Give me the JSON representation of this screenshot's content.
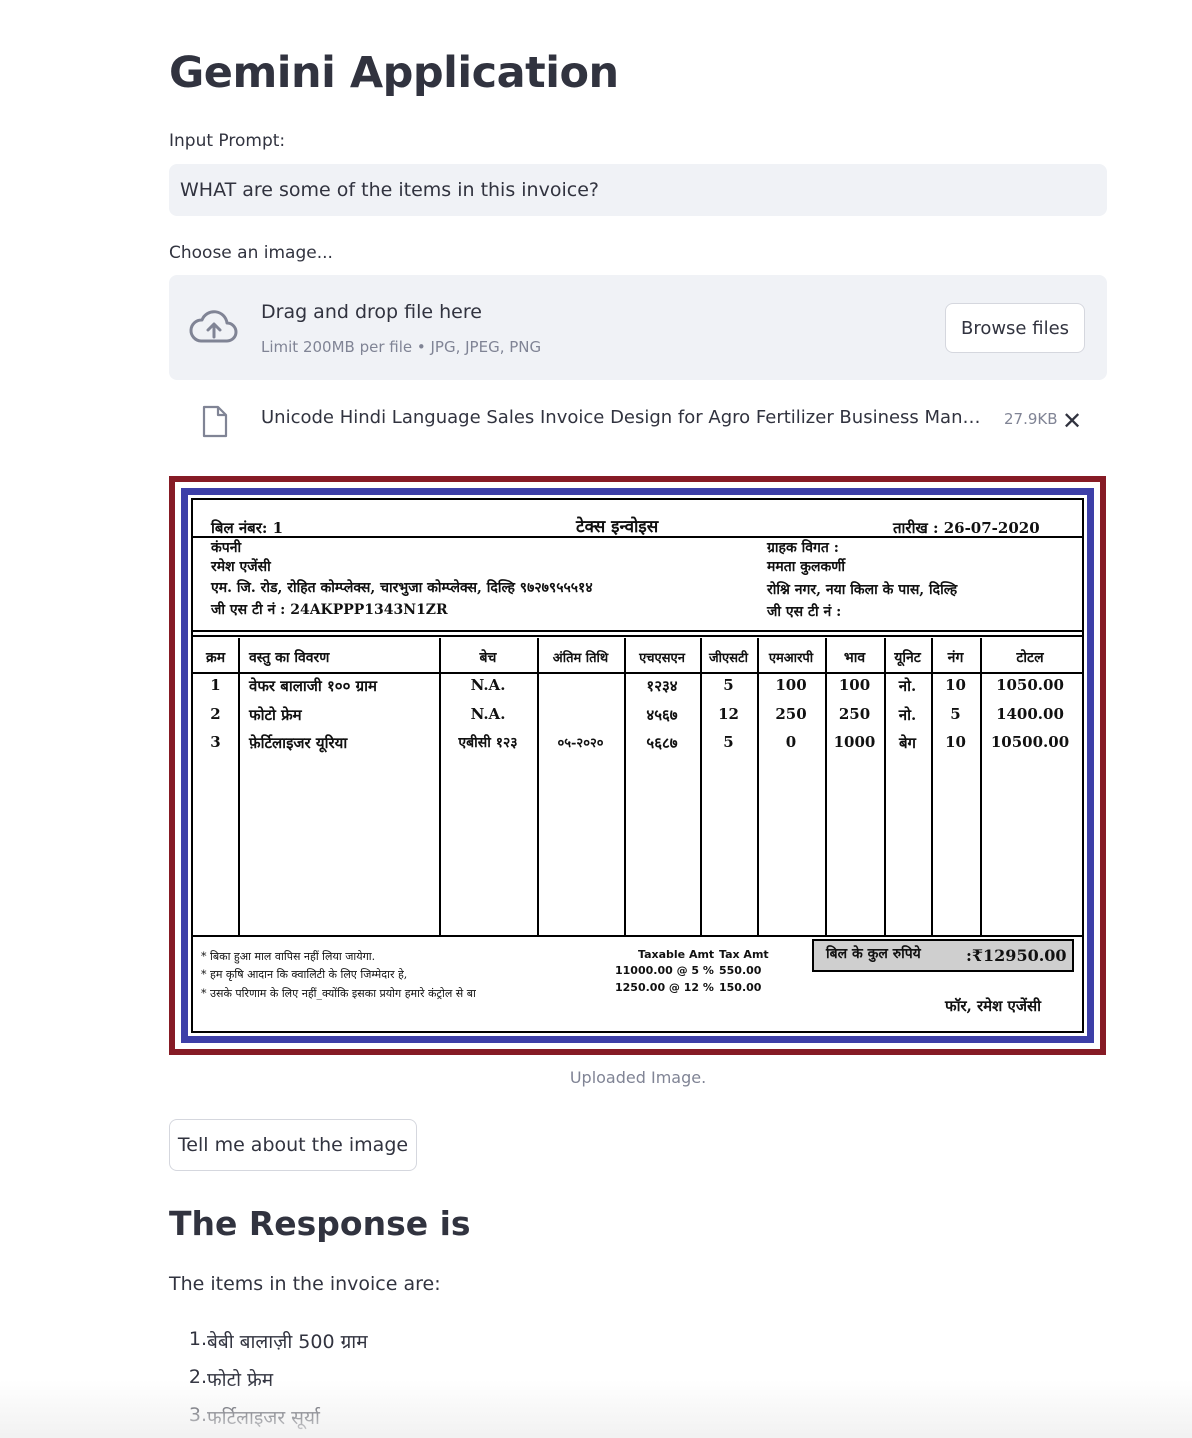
{
  "app": {
    "title": "Gemini Application"
  },
  "prompt": {
    "label": "Input Prompt:",
    "value": "WHAT are some of the items in this invoice?"
  },
  "uploader": {
    "label": "Choose an image...",
    "drop_text": "Drag and drop file here",
    "limit_text": "Limit 200MB per file • JPG, JPEG, PNG",
    "browse_label": "Browse files",
    "file_name": "Unicode Hindi Language Sales Invoice Design for Agro Fertilizer Business Manag…",
    "file_size": "27.9KB",
    "remove_symbol": "✕"
  },
  "invoice": {
    "bill_no": "बिल  नंबर: 1",
    "heading": "टेक्स   इन्वोइस",
    "date": "तारीख :  26-07-2020",
    "company_label": "कंपनी",
    "company_name": "रमेश एजेंसी",
    "company_address": "एम. जि. रोड, रोहित कोम्प्लेक्स, चारभुजा कोम्प्लेक्स, दिल्हि ९७२७९५५५१४",
    "company_gst": "जी एस टी नं : 24AKPPP1343N1ZR",
    "customer_label": "ग्राहक विगत :",
    "customer_name": "ममता कुलकर्णी",
    "customer_address": "रोश्नि नगर, नया किला के पास, दिल्हि",
    "customer_gst": "जी एस टी नं :",
    "columns": [
      "क्रम",
      "वस्तु का विवरण",
      "बेच",
      "अंतिम  तिथि",
      "एचएसएन",
      "जीएसटी",
      "एमआरपी",
      "भाव",
      "यूनिट",
      "नंग",
      "टोटल"
    ],
    "rows": [
      [
        "1",
        "वेफर बालाजी १०० ग्राम",
        "N.A.",
        "",
        "१२३४",
        "5",
        "100",
        "100",
        "नो.",
        "10",
        "1050.00"
      ],
      [
        "2",
        "फोटो फ्रेम",
        "N.A.",
        "",
        "४५६७",
        "12",
        "250",
        "250",
        "नो.",
        "5",
        "1400.00"
      ],
      [
        "3",
        "फ़ेर्टिलाइजर यूरिया",
        "एबीसी १२३",
        "०५-२०२०",
        "५६८७",
        "5",
        "0",
        "1000",
        "बेग",
        "10",
        "10500.00"
      ]
    ],
    "notes": [
      "* बिका हुआ माल वापिस नहीं लिया जायेगा.",
      "* हम कृषि आदान कि क्वालिटी के लिए जिम्मेदार हे,",
      "* उसके परिणाम के लिए नहीं_क्योंकि इसका प्रयोग हमारे कंट्रोल से बा"
    ],
    "tax_header_taxable": "Taxable Amt",
    "tax_header_tax": "Tax Amt",
    "tax_rows": [
      {
        "taxable": "11000.00 @ 5 %",
        "tax": "550.00"
      },
      {
        "taxable": "1250.00 @ 12 %",
        "tax": "150.00"
      }
    ],
    "total_label": "बिल  के  कुल  रुपिये",
    "total_value": ":₹12950.00",
    "signature": "फॉर, रमेश एजेंसी"
  },
  "image_caption": "Uploaded Image.",
  "action": {
    "button_label": "Tell me about the image"
  },
  "response": {
    "title": "The Response is",
    "intro": "The items in the invoice are:",
    "items": [
      "बेबी बालाज़ी 500 ग्राम",
      "फोटो फ्रेम",
      "फर्टिलाइजर सूर्या"
    ]
  },
  "colors": {
    "text": "#31333f",
    "muted": "#808495",
    "input_bg": "#f0f2f6",
    "invoice_border": "#861b25",
    "invoice_inner": "#3d3fa8"
  },
  "icons": [
    "cloud-upload-icon",
    "file-icon",
    "close-icon"
  ]
}
